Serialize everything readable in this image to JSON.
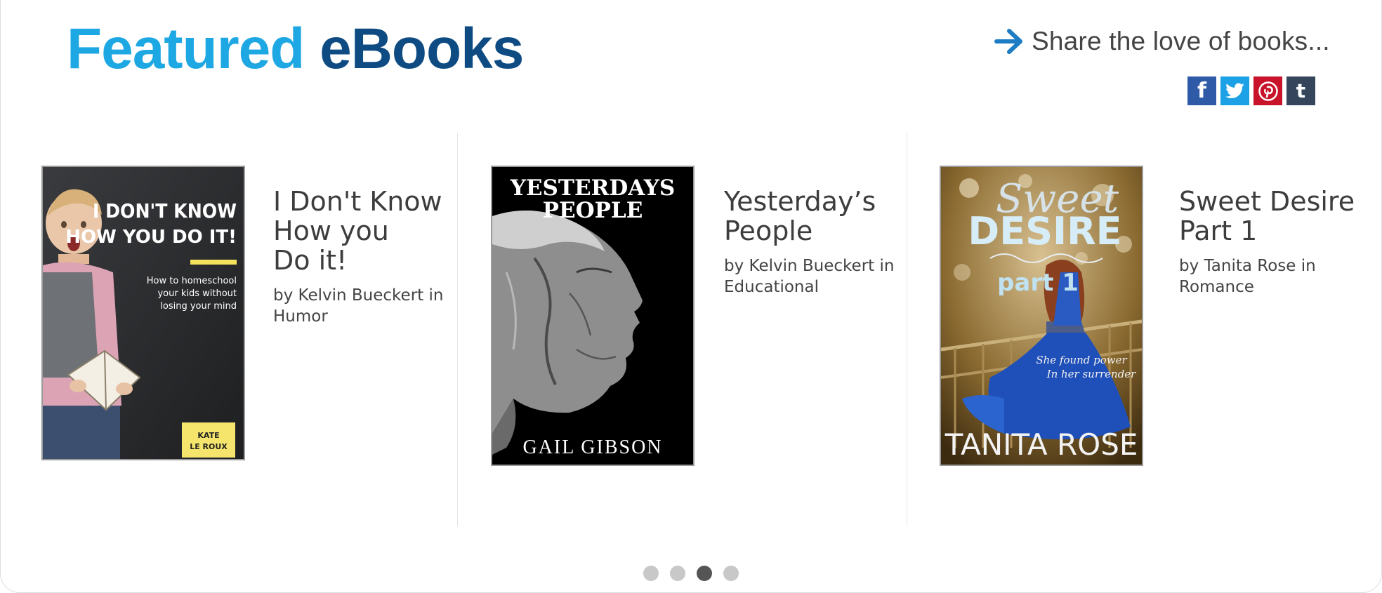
{
  "header": {
    "title_part1": "Featured",
    "title_part2": "eBooks",
    "share_text": "Share the love of books..."
  },
  "social": [
    {
      "name": "facebook",
      "glyph": "f"
    },
    {
      "name": "twitter",
      "glyph": ""
    },
    {
      "name": "pinterest",
      "glyph": ""
    },
    {
      "name": "tumblr",
      "glyph": "t"
    }
  ],
  "books": [
    {
      "title": "I Don't Know\nHow you\nDo it!",
      "by": "by",
      "author": "Kelvin Bueckert",
      "in": "in",
      "category": "Humor",
      "cover": {
        "headline_1": "I DON'T KNOW",
        "headline_2": "HOW YOU DO IT!",
        "subtitle_1": "How to homeschool",
        "subtitle_2": "your kids without",
        "subtitle_3": "losing your mind",
        "author_1": "KATE",
        "author_2": "LE ROUX"
      }
    },
    {
      "title": "Yesterday’s\nPeople",
      "by": "by",
      "author": "Kelvin Bueckert",
      "in": "in",
      "category": "Educational",
      "cover": {
        "headline_1": "YESTERDAYS",
        "headline_2": "PEOPLE",
        "author": "GAIL GIBSON"
      }
    },
    {
      "title": "Sweet Desire\nPart 1",
      "by": "by",
      "author": "Tanita Rose",
      "in": "in",
      "category": "Romance",
      "cover": {
        "script": "Sweet",
        "headline": "DESIRE",
        "part": "part 1",
        "tagline_1": "She found power",
        "tagline_2": "In her surrender",
        "author": "TANITA ROSE"
      }
    }
  ],
  "pagination": {
    "count": 4,
    "active_index": 2
  },
  "colors": {
    "title_light": "#1ea8e3",
    "title_dark": "#0d4b82",
    "facebook": "#2f5aa8",
    "twitter": "#1ca0e6",
    "pinterest": "#c8132a",
    "tumblr": "#35465c",
    "dot_active": "#555555",
    "dot_inactive": "#c8c8c8"
  }
}
